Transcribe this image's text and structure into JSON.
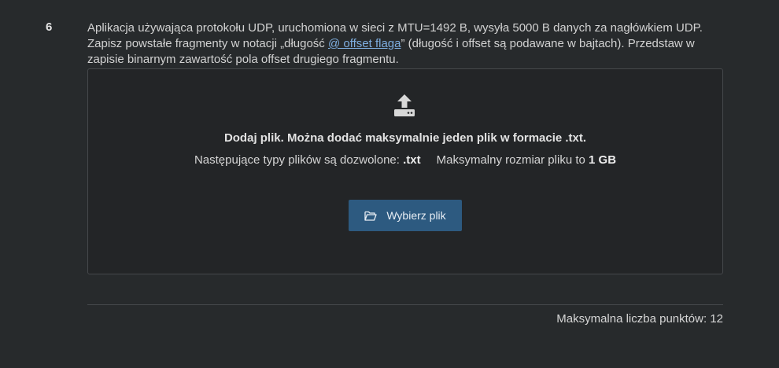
{
  "question": {
    "number": "6",
    "text_part1": "Aplikacja używająca protokołu UDP, uruchomiona w sieci z MTU=1492 B, wysyła 5000 B danych za nagłówkiem UDP. Zapisz powstałe fragmenty w notacji „długość ",
    "link_text": "@ offset flaga",
    "text_part2": "” (długość i offset są podawane w bajtach). Przedstaw w zapisie binarnym zawartość pola offset drugiego fragmentu."
  },
  "upload": {
    "icon": "upload-icon",
    "title": "Dodaj plik. Można dodać maksymalnie jeden plik w formacie .txt.",
    "types_label": "Następujące typy plików są dozwolone:",
    "types_value": ".txt",
    "size_label": "Maksymalny rozmiar pliku to",
    "size_value": "1 GB",
    "button_icon": "folder-open-icon",
    "button_label": "Wybierz plik"
  },
  "footer": {
    "max_points": "Maksymalna liczba punktów: 12"
  },
  "colors": {
    "background": "#272a2c",
    "button": "#2d5a80",
    "link": "#7eaee0"
  }
}
